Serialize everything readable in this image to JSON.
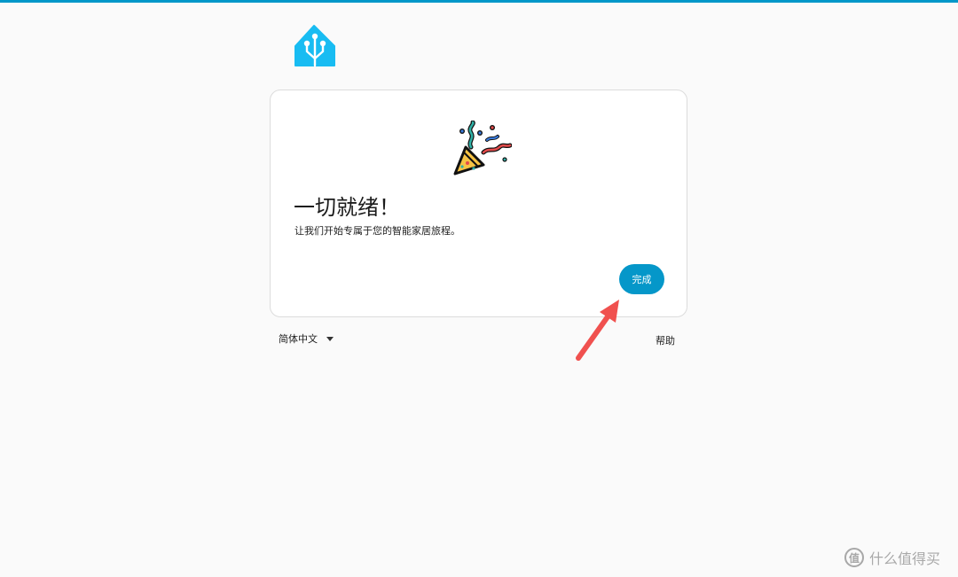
{
  "app": {
    "logo_icon": "home-assistant-logo-icon",
    "accent_color": "#0097c9"
  },
  "card": {
    "illustration_icon": "party-popper-icon",
    "title": "一切就绪！",
    "subtitle": "让我们开始专属于您的智能家居旅程。",
    "finish_label": "完成",
    "button_color": "#0597c9"
  },
  "footer": {
    "language": "简体中文",
    "language_icon": "caret-down-icon",
    "help": "帮助"
  },
  "annotation": {
    "icon": "red-arrow-icon",
    "color": "#f0514f"
  },
  "watermark": {
    "icon_glyph": "值",
    "text": "什么值得买"
  }
}
